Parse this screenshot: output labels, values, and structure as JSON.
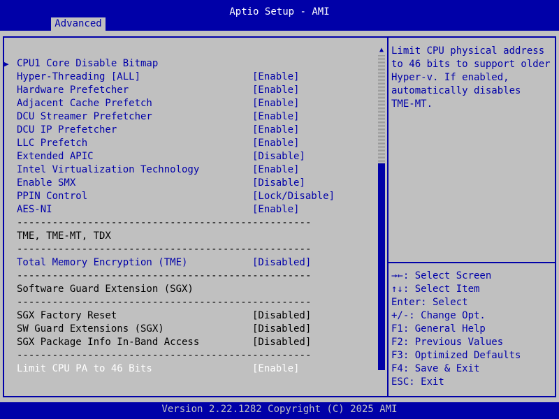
{
  "title": "Aptio Setup - AMI",
  "active_tab": "Advanced",
  "submenu": {
    "arrow_icon": "triangle-right-icon",
    "label": "CPU1 Core Disable Bitmap"
  },
  "settings_a": [
    {
      "label": "Hyper-Threading [ALL]",
      "value": "[Enable]"
    },
    {
      "label": "Hardware Prefetcher",
      "value": "[Enable]"
    },
    {
      "label": "Adjacent Cache Prefetch",
      "value": "[Enable]"
    },
    {
      "label": "DCU Streamer Prefetcher",
      "value": "[Enable]"
    },
    {
      "label": "DCU IP Prefetcher",
      "value": "[Enable]"
    },
    {
      "label": "LLC Prefetch",
      "value": "[Enable]"
    },
    {
      "label": "Extended APIC",
      "value": "[Disable]"
    },
    {
      "label": "Intel Virtualization Technology",
      "value": "[Enable]"
    },
    {
      "label": "Enable SMX",
      "value": "[Disable]"
    },
    {
      "label": "PPIN Control",
      "value": "[Lock/Disable]"
    },
    {
      "label": "AES-NI",
      "value": "[Enable]"
    }
  ],
  "separator": "--------------------------------------------------",
  "tme_heading": "TME, TME-MT, TDX",
  "tme_setting": {
    "label": "Total Memory Encryption (TME)",
    "value": "[Disabled]"
  },
  "sgx_heading": "Software Guard Extension (SGX)",
  "sgx_settings": [
    {
      "label": "SGX Factory Reset",
      "value": "[Disabled]"
    },
    {
      "label": "SW Guard Extensions (SGX)",
      "value": "[Disabled]"
    },
    {
      "label": "SGX Package Info In-Band Access",
      "value": "[Disabled]"
    }
  ],
  "selected_setting": {
    "label": "Limit CPU PA to 46 Bits",
    "value": "[Enable]"
  },
  "help_text": [
    "Limit CPU physical address",
    "to 46 bits to support older",
    "Hyper-v. If enabled,",
    "automatically disables",
    "TME-MT."
  ],
  "key_help": [
    "→←: Select Screen",
    "↑↓: Select Item",
    "Enter: Select",
    "+/-: Change Opt.",
    "F1: General Help",
    "F2: Previous Values",
    "F3: Optimized Defaults",
    "F4: Save & Exit",
    "ESC: Exit"
  ],
  "version": "Version 2.22.1282 Copyright (C) 2025 AMI",
  "colors": {
    "bios_blue": "#0000a8",
    "panel_gray": "#c0c0c0",
    "highlight_white": "#ffffff"
  }
}
